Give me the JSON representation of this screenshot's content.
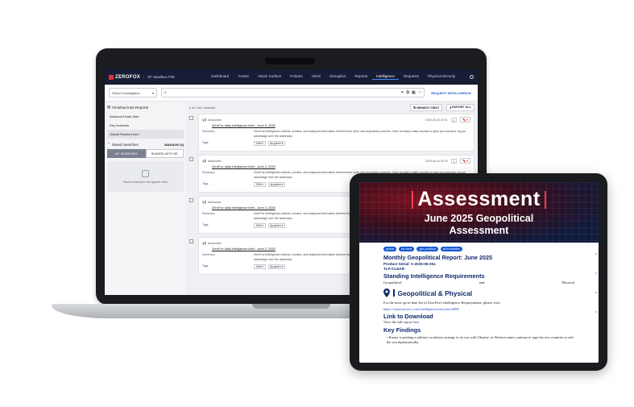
{
  "nav": {
    "brand": "ZEROFOX",
    "tenant": "ZF Sandbox FMI",
    "items": [
      "Dashboard",
      "Assets",
      "Attack Surface",
      "Policies",
      "Alerts",
      "Disruption",
      "Reports",
      "Intelligence",
      "Requests",
      "Physical Security"
    ],
    "active_index": 7
  },
  "toolbar": {
    "select_label": "Select Investigation",
    "search_placeholder": "",
    "request_label": "REQUEST INTELLIGENCE"
  },
  "sidebar": {
    "header": "Finished Intel Reports",
    "items": [
      "Advanced Dark Web",
      "Key Incidents",
      "Global Finished Intel"
    ],
    "active_index": 2,
    "saved_label": "Saved Searches",
    "manage_label": "MANAGE (0)",
    "tab_my": "MY SEARCHES",
    "tab_shared": "SHARED WITH ME",
    "empty_text": "Saved searches will appear here"
  },
  "main": {
    "count": "0 of 2.5k+ selected",
    "sort_label": "NEWEST FIRST",
    "export_label": "EXPORT ALL",
    "cards": [
      {
        "type": "Advisories",
        "date": "2025-06-05 09:41",
        "title": "ZeroFox daily intelligence brief - June 5, 2025",
        "summary_label": "Summary",
        "summary": "ZeroFox Intelligence collects, curates, and analyzes information derived from open and proprietary sources. Here is today's daily roundup to give you and your org an advantage over the adversary.",
        "tags_label": "Tags",
        "tag1": "Drill",
        "tag2": "tlp:green"
      },
      {
        "type": "Advisories",
        "date": "2025-06-04 09:33",
        "title": "ZeroFox daily intelligence brief - June 4, 2025",
        "summary_label": "Summary",
        "summary": "ZeroFox Intelligence collects, curates, and analyzes information derived from open and proprietary sources. Here is today's daily roundup to give you and your org an advantage over the adversary.",
        "tags_label": "Tags",
        "tag1": "Drill",
        "tag2": "tlp:green"
      },
      {
        "type": "Advisories",
        "date": "",
        "title": "ZeroFox daily intelligence brief - June 3, 2025",
        "summary_label": "Summary",
        "summary": "ZeroFox Intelligence collects, curates, and analyzes information derived from open and proprietary sources. Here is today's daily roundup to give you and your org an advantage over the adversary.",
        "tags_label": "Tags",
        "tag1": "Drill",
        "tag2": "tlp:green"
      },
      {
        "type": "Advisories",
        "date": "",
        "title": "ZeroFox daily intelligence brief - June 2, 2025",
        "summary_label": "Summary",
        "summary": "ZeroFox Intelligence collects, curates, and analyzes information derived from open and proprietary sources. Here is today's daily roundup to give you and your org an advantage over the adversary.",
        "tags_label": "Tags",
        "tag1": "Drill",
        "tag2": "tlp:green"
      }
    ]
  },
  "tablet": {
    "hero_title": "Assessment",
    "hero_sub1": "June 2025 Geopolitical",
    "hero_sub2": "Assessment",
    "chips": [
      "global",
      "tlp:clear",
      "geo-political",
      "all industries"
    ],
    "report_title": "Monthly Geopolitical Report: June 2025",
    "serial": "Product Serial: A-2025-05-30a",
    "tlp": "TLP:CLEAR",
    "sir_heading": "Standing Intelligence Requirements",
    "sir_left": "Geopolitical",
    "sir_mid": "and",
    "sir_right": "Physical",
    "geo_heading": "Geopolitical & Physical",
    "para": "For the most up-to-date list of ZeroFox's Intelligence Requirements, please visit:",
    "url": "https://cloud.zerofox.com/intelligence/advisories/4896",
    "link_heading": "Link to Download",
    "view_text": "View the full report ",
    "view_link": "here",
    "view_end": ".",
    "findings_heading": "Key Findings",
    "finding1": "Russia is pushing a military escalation strategy in its war with Ukraine, as Western states continue to urge the two countries to end the war diplomatically."
  },
  "colors": {
    "nav_bg": "#161d34",
    "accent": "#1558d6",
    "brand_red": "#e0323d",
    "heading": "#102a6b"
  }
}
